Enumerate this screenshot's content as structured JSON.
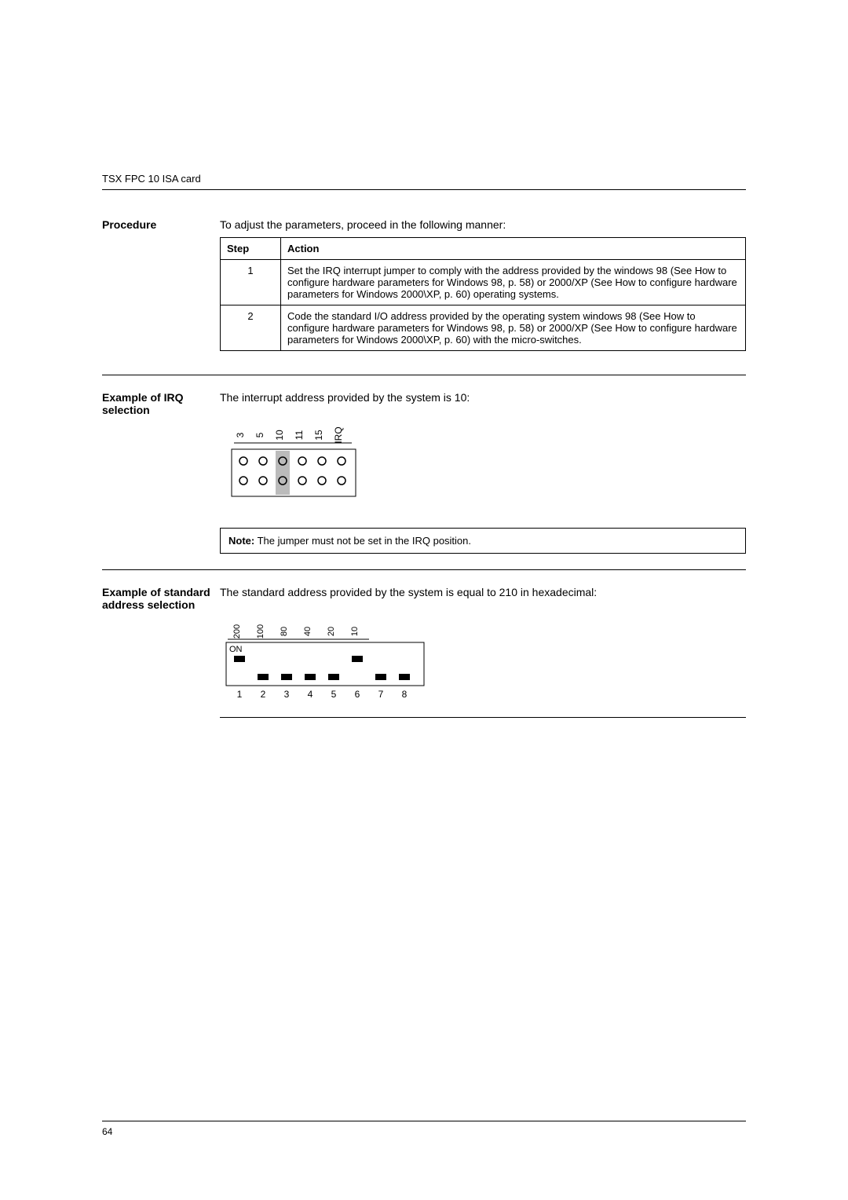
{
  "running_head": "TSX FPC 10 ISA card",
  "section_procedure": {
    "label": "Procedure",
    "intro": "To adjust the parameters, proceed in the following manner:",
    "table": {
      "headers": {
        "step": "Step",
        "action": "Action"
      },
      "rows": [
        {
          "step": "1",
          "action": "Set the IRQ interrupt jumper to comply with the address provided by the windows 98 (See How to configure hardware parameters for Windows 98, p. 58) or 2000/XP (See How to configure hardware parameters for Windows 2000\\XP, p. 60) operating systems."
        },
        {
          "step": "2",
          "action": "Code the standard I/O address provided by the operating system windows 98 (See How to configure hardware parameters for Windows 98, p. 58) or 2000/XP (See How to configure hardware parameters for Windows 2000\\XP, p. 60) with the micro-switches."
        }
      ]
    }
  },
  "section_irq": {
    "label": "Example of IRQ selection",
    "intro": "The interrupt address provided by the system is 10:",
    "pins": [
      "3",
      "5",
      "10",
      "11",
      "15",
      "IRQ"
    ],
    "selected_col_index": 2,
    "note_prefix": "Note:",
    "note_text": " The jumper must not be set in the IRQ position."
  },
  "section_addr": {
    "label": "Example of standard address selection",
    "intro": "The standard address provided by the system is equal to 210 in hexadecimal:",
    "weights": [
      "200",
      "100",
      "80",
      "40",
      "20",
      "10"
    ],
    "on_label": "ON",
    "switch_numbers": [
      "1",
      "2",
      "3",
      "4",
      "5",
      "6",
      "7",
      "8"
    ],
    "switch_up": [
      true,
      false,
      false,
      false,
      false,
      true,
      false,
      false
    ],
    "switch_down": [
      false,
      true,
      true,
      true,
      true,
      false,
      true,
      true
    ]
  },
  "page_number": "64"
}
